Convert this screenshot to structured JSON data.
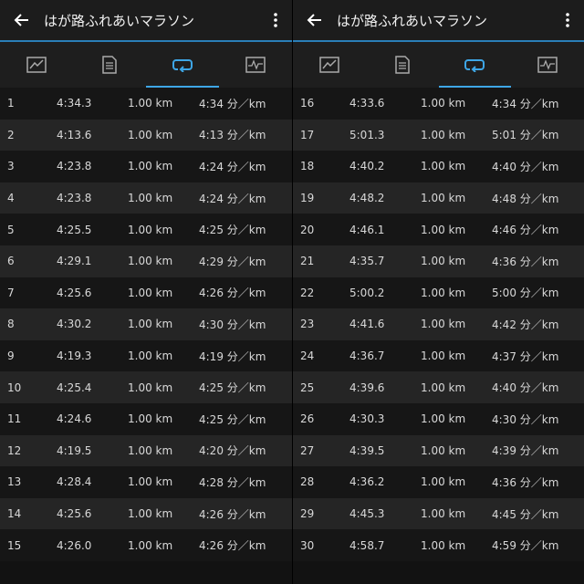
{
  "app": {
    "title": "はが路ふれあいマラソン",
    "icons": {
      "back": "back-arrow-icon",
      "more": "more-vert-icon",
      "tabs": [
        "summary-chart-icon",
        "document-icon",
        "laps-loop-icon",
        "heart-rate-icon"
      ]
    },
    "colors": {
      "accent": "#3ea6e6",
      "header": "#1c1c1c",
      "row_dark": "#161616",
      "row_light": "#252525"
    }
  },
  "left": {
    "laps": [
      {
        "lap": "1",
        "time": "4:34.3",
        "dist": "1.00 km",
        "pace": "4:34 分／km"
      },
      {
        "lap": "2",
        "time": "4:13.6",
        "dist": "1.00 km",
        "pace": "4:13 分／km"
      },
      {
        "lap": "3",
        "time": "4:23.8",
        "dist": "1.00 km",
        "pace": "4:24 分／km"
      },
      {
        "lap": "4",
        "time": "4:23.8",
        "dist": "1.00 km",
        "pace": "4:24 分／km"
      },
      {
        "lap": "5",
        "time": "4:25.5",
        "dist": "1.00 km",
        "pace": "4:25 分／km"
      },
      {
        "lap": "6",
        "time": "4:29.1",
        "dist": "1.00 km",
        "pace": "4:29 分／km"
      },
      {
        "lap": "7",
        "time": "4:25.6",
        "dist": "1.00 km",
        "pace": "4:26 分／km"
      },
      {
        "lap": "8",
        "time": "4:30.2",
        "dist": "1.00 km",
        "pace": "4:30 分／km"
      },
      {
        "lap": "9",
        "time": "4:19.3",
        "dist": "1.00 km",
        "pace": "4:19 分／km"
      },
      {
        "lap": "10",
        "time": "4:25.4",
        "dist": "1.00 km",
        "pace": "4:25 分／km"
      },
      {
        "lap": "11",
        "time": "4:24.6",
        "dist": "1.00 km",
        "pace": "4:25 分／km"
      },
      {
        "lap": "12",
        "time": "4:19.5",
        "dist": "1.00 km",
        "pace": "4:20 分／km"
      },
      {
        "lap": "13",
        "time": "4:28.4",
        "dist": "1.00 km",
        "pace": "4:28 分／km"
      },
      {
        "lap": "14",
        "time": "4:25.6",
        "dist": "1.00 km",
        "pace": "4:26 分／km"
      },
      {
        "lap": "15",
        "time": "4:26.0",
        "dist": "1.00 km",
        "pace": "4:26 分／km"
      }
    ]
  },
  "right": {
    "laps": [
      {
        "lap": "16",
        "time": "4:33.6",
        "dist": "1.00 km",
        "pace": "4:34 分／km"
      },
      {
        "lap": "17",
        "time": "5:01.3",
        "dist": "1.00 km",
        "pace": "5:01 分／km"
      },
      {
        "lap": "18",
        "time": "4:40.2",
        "dist": "1.00 km",
        "pace": "4:40 分／km"
      },
      {
        "lap": "19",
        "time": "4:48.2",
        "dist": "1.00 km",
        "pace": "4:48 分／km"
      },
      {
        "lap": "20",
        "time": "4:46.1",
        "dist": "1.00 km",
        "pace": "4:46 分／km"
      },
      {
        "lap": "21",
        "time": "4:35.7",
        "dist": "1.00 km",
        "pace": "4:36 分／km"
      },
      {
        "lap": "22",
        "time": "5:00.2",
        "dist": "1.00 km",
        "pace": "5:00 分／km"
      },
      {
        "lap": "23",
        "time": "4:41.6",
        "dist": "1.00 km",
        "pace": "4:42 分／km"
      },
      {
        "lap": "24",
        "time": "4:36.7",
        "dist": "1.00 km",
        "pace": "4:37 分／km"
      },
      {
        "lap": "25",
        "time": "4:39.6",
        "dist": "1.00 km",
        "pace": "4:40 分／km"
      },
      {
        "lap": "26",
        "time": "4:30.3",
        "dist": "1.00 km",
        "pace": "4:30 分／km"
      },
      {
        "lap": "27",
        "time": "4:39.5",
        "dist": "1.00 km",
        "pace": "4:39 分／km"
      },
      {
        "lap": "28",
        "time": "4:36.2",
        "dist": "1.00 km",
        "pace": "4:36 分／km"
      },
      {
        "lap": "29",
        "time": "4:45.3",
        "dist": "1.00 km",
        "pace": "4:45 分／km"
      },
      {
        "lap": "30",
        "time": "4:58.7",
        "dist": "1.00 km",
        "pace": "4:59 分／km"
      }
    ]
  }
}
